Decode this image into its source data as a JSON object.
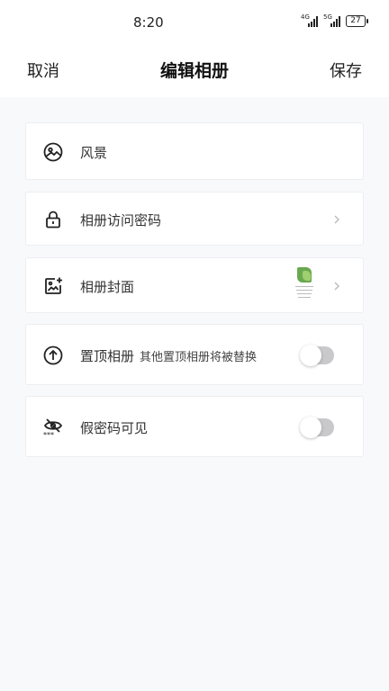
{
  "status": {
    "time": "8:20",
    "signal1": "4G",
    "signal2": "5G",
    "battery": "27"
  },
  "header": {
    "cancel": "取消",
    "title": "编辑相册",
    "save": "保存"
  },
  "rows": {
    "name": {
      "label": "风景",
      "icon": "landscape-icon"
    },
    "password": {
      "label": "相册访问密码",
      "icon": "lock-icon"
    },
    "cover": {
      "label": "相册封面",
      "icon": "image-add-icon"
    },
    "pin": {
      "label": "置顶相册",
      "hint": "其他置顶相册将被替换",
      "icon": "arrow-up-circle-icon",
      "enabled": false
    },
    "fake": {
      "label": "假密码可见",
      "icon": "eye-off-icon",
      "enabled": false
    }
  },
  "colors": {
    "toggle_off": "#c9c9cc",
    "background": "#f8f9fb",
    "text": "#222222"
  }
}
